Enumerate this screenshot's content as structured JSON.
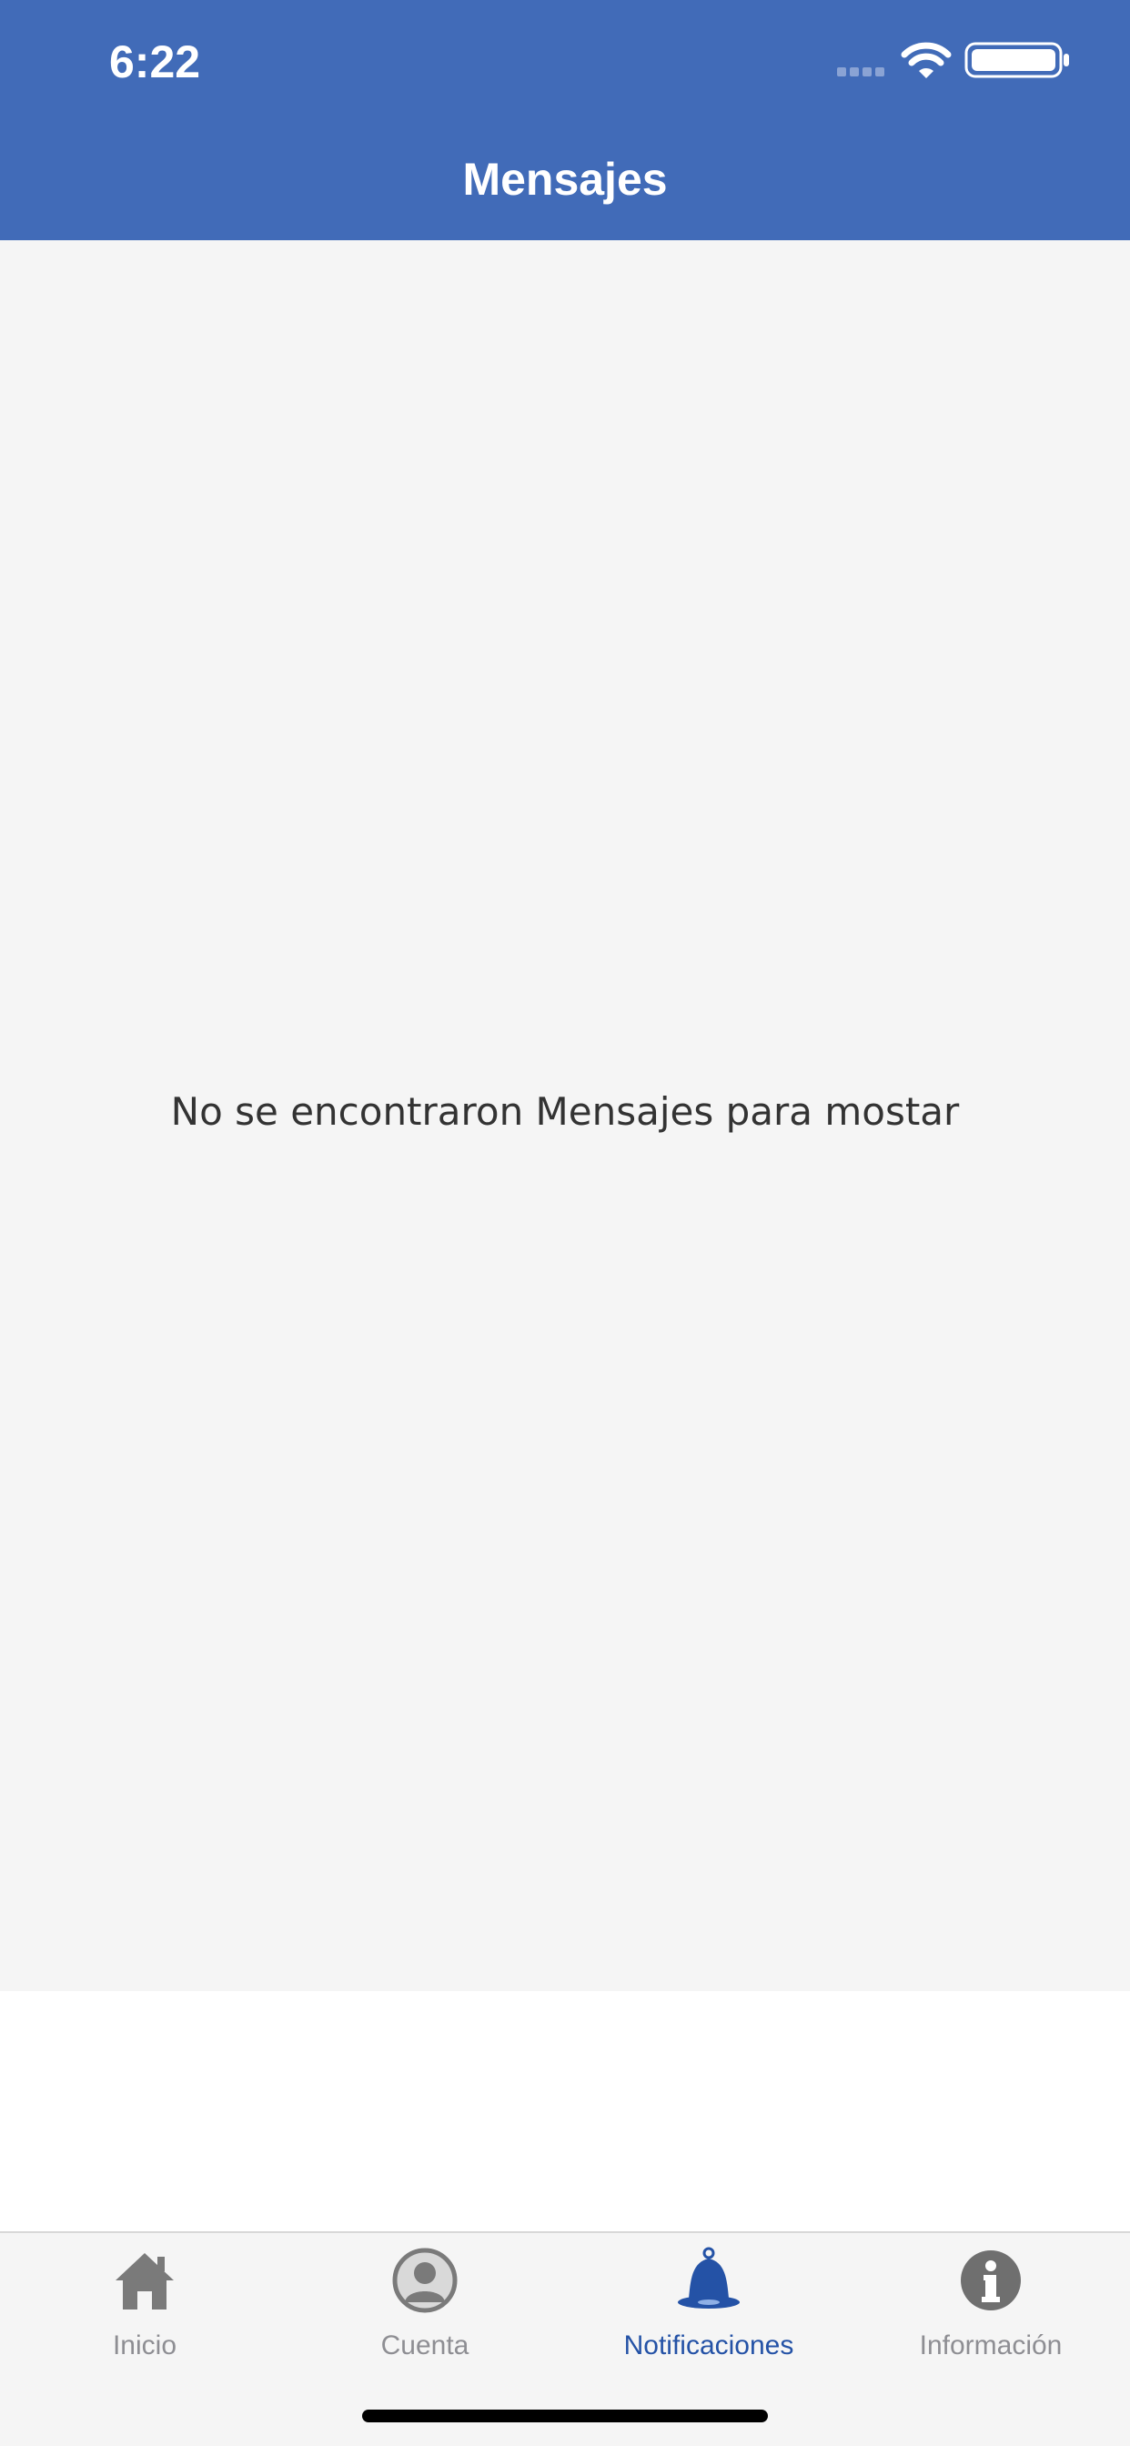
{
  "status_bar": {
    "time": "6:22",
    "wifi_icon": "wifi-icon",
    "battery_icon": "battery-icon",
    "signal_icon": "signal-dots-icon"
  },
  "nav": {
    "title": "Mensajes"
  },
  "content": {
    "empty_message": "No se encontraron Mensajes para mostar"
  },
  "tabbar": {
    "items": [
      {
        "label": "Inicio",
        "icon": "home-icon",
        "active": false
      },
      {
        "label": "Cuenta",
        "icon": "account-icon",
        "active": false
      },
      {
        "label": "Notificaciones",
        "icon": "bell-icon",
        "active": true
      },
      {
        "label": "Información",
        "icon": "info-icon",
        "active": false
      }
    ]
  },
  "colors": {
    "header_bg": "#416bb8",
    "active_tab": "#2452a6",
    "inactive_tab": "#8e8e93",
    "content_bg": "#f5f5f5"
  }
}
